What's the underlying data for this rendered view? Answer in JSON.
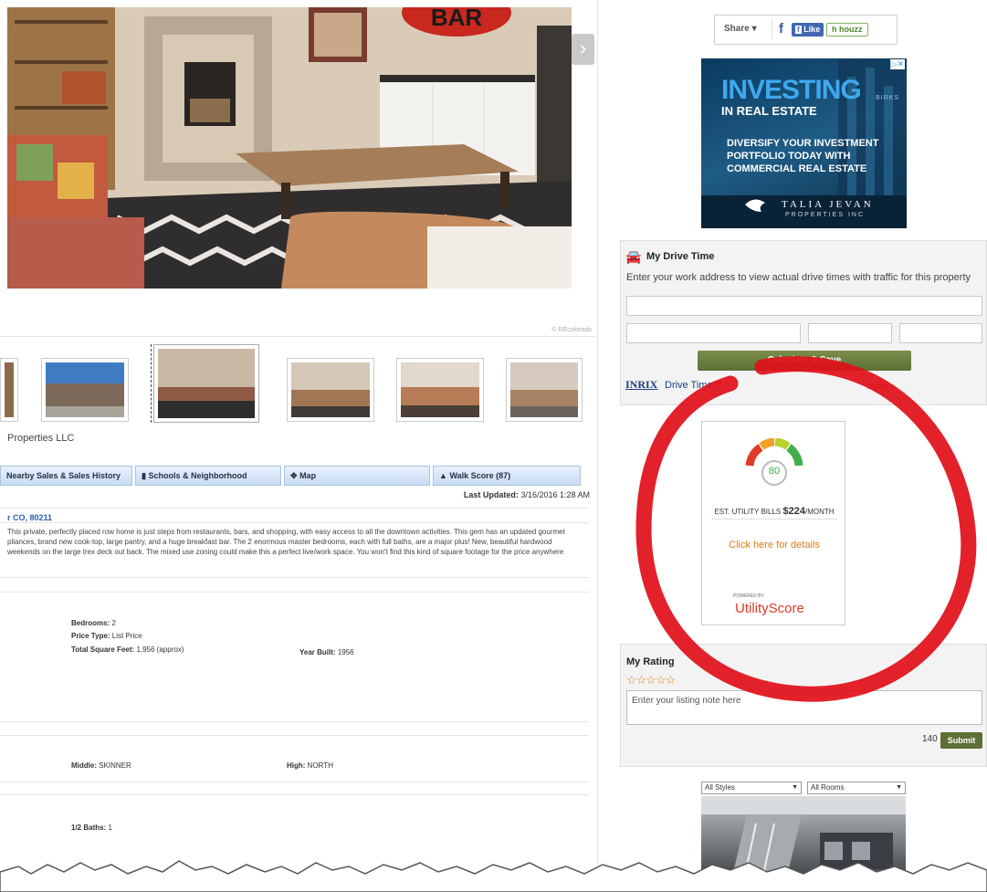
{
  "photo": {
    "credit": "© REcolorado",
    "sign_text": "BAR"
  },
  "listing": {
    "broker": "Properties LLC",
    "tabs": [
      "Nearby Sales & Sales History",
      "Schools & Neighborhood",
      "Map",
      "Walk Score (87)"
    ],
    "last_updated_label": "Last Updated:",
    "last_updated_value": "3/16/2016 1:28 AM",
    "address": "r CO, 80211",
    "description": [
      "This private, perfectly placed row home is just steps from restaurants, bars, and shopping, with easy access to all the downtown activities. This gem has an updated gourmet",
      "pliances, brand new cook-top, large pantry, and a huge breakfast bar. The 2 enormous master bedrooms, each with full baths, are a major plus! New, beautiful hardwood",
      "weekends on the large trex deck out back. The mixed use zoning could make this a perfect live/work space. You won't find this kind of square footage for the price anywhere"
    ],
    "facts": {
      "bedrooms_label": "Bedrooms:",
      "bedrooms": "2",
      "price_type_label": "Price Type:",
      "price_type": "List Price",
      "sqft_label": "Total Square Feet:",
      "sqft": "1,956 (approx)",
      "year_label": "Year Built:",
      "year": "1956",
      "middle_label": "Middle:",
      "middle": "SKINNER",
      "high_label": "High:",
      "high": "NORTH",
      "half_baths_label": "1/2 Baths:",
      "half_baths": "1"
    }
  },
  "share": {
    "label": "Share",
    "like": "Like",
    "houzz": "houzz"
  },
  "ad": {
    "headline": "INVESTING",
    "subhead": "IN REAL ESTATE",
    "line1": "DIVERSIFY YOUR INVESTMENT",
    "line2": "PORTFOLIO TODAY WITH",
    "line3": "COMMERCIAL REAL ESTATE",
    "brand": "TALIA JEVAN",
    "brand_sub": "PROPERTIES INC",
    "corner": "BIRKS"
  },
  "drive_time": {
    "title": "My Drive Time",
    "instructions": "Enter your work address to view actual drive times with traffic for this property",
    "button": "Calculate & Save",
    "inrix": "INRIX",
    "drive_time_brand": "Drive Time™",
    "sample": "mple"
  },
  "utility": {
    "score": "80",
    "bills_label": "EST. UTILITY BILLS",
    "bills_value": "$224",
    "bills_unit": "/MONTH",
    "details_link": "Click here for details",
    "powered_by": "POWERED BY",
    "brand": "UtilityScore"
  },
  "rating": {
    "title": "My Rating",
    "stars": "☆☆☆☆☆",
    "placeholder": "Enter your listing note here",
    "char_count": "140",
    "submit": "Submit"
  },
  "houzz_widget": {
    "styles": "All Styles",
    "rooms": "All Rooms"
  },
  "colors": {
    "annotation_red": "#e0101a",
    "button_green": "#5d6f35",
    "link_orange": "#e07b14",
    "tab_blue": "#c9ddf4"
  }
}
